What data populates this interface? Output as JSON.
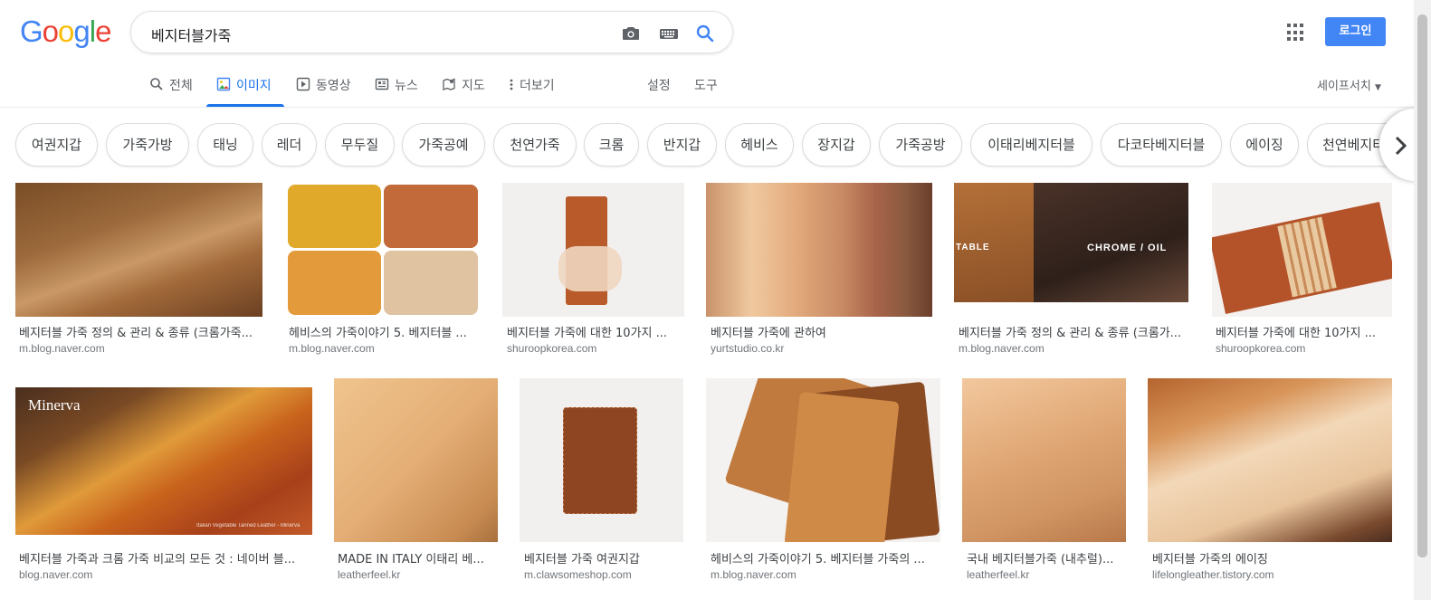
{
  "header": {
    "logo_letters": [
      "G",
      "o",
      "o",
      "g",
      "l",
      "e"
    ],
    "logo_colors": [
      "#4285f4",
      "#ea4335",
      "#fbbc05",
      "#4285f4",
      "#34a853",
      "#ea4335"
    ],
    "query": "베지터블가죽",
    "login_label": "로그인"
  },
  "tabs": [
    {
      "label": "전체",
      "icon": "search-icon"
    },
    {
      "label": "이미지",
      "icon": "image-icon",
      "active": true
    },
    {
      "label": "동영상",
      "icon": "video-icon"
    },
    {
      "label": "뉴스",
      "icon": "news-icon"
    },
    {
      "label": "지도",
      "icon": "map-icon"
    },
    {
      "label": "더보기",
      "icon": "more-vert-icon"
    },
    {
      "label": "설정"
    },
    {
      "label": "도구"
    }
  ],
  "safesearch_label": "세이프서치",
  "chips": [
    "여권지갑",
    "가죽가방",
    "태닝",
    "레더",
    "무두질",
    "가죽공예",
    "천연가죽",
    "크롬",
    "반지갑",
    "헤비스",
    "장지갑",
    "가죽공방",
    "이태리베지터블",
    "다코타베지터블",
    "에이징",
    "천연베지터블"
  ],
  "results": [
    {
      "title": "베지터블 가죽 정의 & 관리 & 종류 (크롬가죽...",
      "source": "m.blog.naver.com",
      "colors": [
        "#8a5a2e",
        "#c89060",
        "#6b4022"
      ]
    },
    {
      "title": "헤비스의 가죽이야기 5. 베지터블 ...",
      "source": "m.blog.naver.com",
      "colors": [
        "#e0a92a",
        "#c26a3a",
        "#e39a3a",
        "#e0c3a0"
      ]
    },
    {
      "title": "베지터블 가죽에 대한 10가지 ...",
      "source": "shuroopkorea.com",
      "colors": [
        "#f2f0ee",
        "#b85a2a"
      ]
    },
    {
      "title": "베지터블 가죽에 관하여",
      "source": "yurtstudio.co.kr",
      "colors": [
        "#e8b88a",
        "#c08a66",
        "#7a4a30"
      ]
    },
    {
      "title": "베지터블 가죽 정의 & 관리 & 종류 (크롬가...",
      "source": "m.blog.naver.com",
      "colors": [
        "#a0642e",
        "#3a2a22"
      ],
      "overlay_left": "TABLE",
      "overlay_right": "CHROME / OIL"
    },
    {
      "title": "베지터블 가죽에 대한 10가지 ...",
      "source": "shuroopkorea.com",
      "colors": [
        "#f4f2f0",
        "#b4532a",
        "#e8c9a0"
      ]
    },
    {
      "title": "베지터블 가죽과 크롬 가죽 비교의 모든 것 : 네이버 블...",
      "source": "blog.naver.com",
      "colors": [
        "#5a3a22",
        "#d98a2a",
        "#b8451e"
      ],
      "overlay_left": "Minerva",
      "overlay_caption": "Italian Vegetable Tanned Leather - Minerva"
    },
    {
      "title": "MADE IN ITALY 이태리 베...",
      "source": "leatherfeel.kr",
      "colors": [
        "#e6b27a",
        "#d19a5a"
      ]
    },
    {
      "title": "베지터블 가죽 여권지갑",
      "source": "m.clawsomeshop.com",
      "colors": [
        "#f2f0ee",
        "#8e4522"
      ]
    },
    {
      "title": "헤비스의 가죽이야기 5. 베지터블 가죽의 ...",
      "source": "m.blog.naver.com",
      "colors": [
        "#f4f2f0",
        "#c07a3e",
        "#8a4a22"
      ]
    },
    {
      "title": "국내 베지터블가죽 (내추럴)...",
      "source": "leatherfeel.kr",
      "colors": [
        "#e2aa78",
        "#cf9462"
      ]
    },
    {
      "title": "베지터블 가죽의 에이징",
      "source": "lifelongleather.tistory.com",
      "colors": [
        "#f3d8b8",
        "#b5642e",
        "#5a3422"
      ]
    }
  ]
}
